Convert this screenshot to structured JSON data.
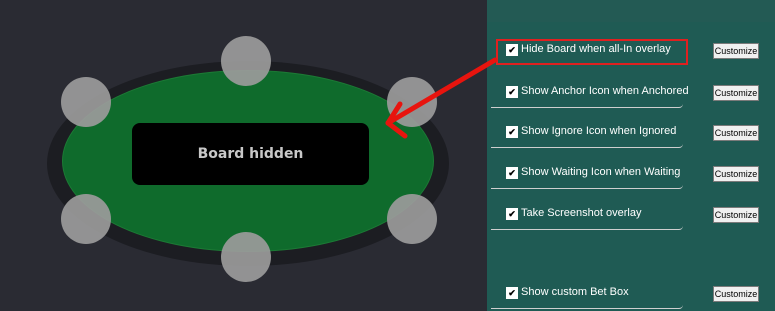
{
  "board": {
    "text": "Board hidden"
  },
  "options": [
    {
      "label": "Hide Board when all-In overlay",
      "checked": true,
      "button": "Customize"
    },
    {
      "label": "Show Anchor Icon when Anchored",
      "checked": true,
      "button": "Customize"
    },
    {
      "label": "Show Ignore Icon when Ignored",
      "checked": true,
      "button": "Customize"
    },
    {
      "label": "Show Waiting Icon when Waiting",
      "checked": true,
      "button": "Customize"
    },
    {
      "label": "Take Screenshot overlay",
      "checked": true,
      "button": "Customize"
    },
    {
      "label": "Show custom Bet Box",
      "checked": true,
      "button": "Customize"
    }
  ],
  "colors": {
    "highlight": "#e02020",
    "felt": "#0f6b2c",
    "panel": "#1f5b54"
  },
  "checkmark": "✔"
}
